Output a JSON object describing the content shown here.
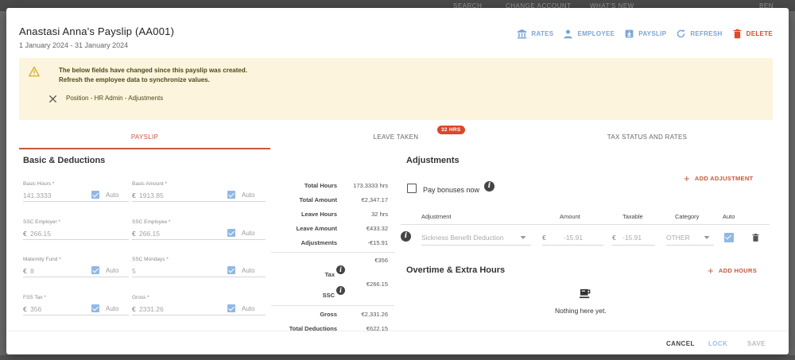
{
  "background": {
    "topbar_texts": [
      "SEARCH",
      "CHANGE ACCOUNT",
      "WHAT'S NEW",
      "BEN"
    ]
  },
  "header": {
    "title": "Anastasi Anna's Payslip (AA001)",
    "period": "1 January 2024 - 31 January 2024"
  },
  "toolbar": {
    "rates": "RATES",
    "employee": "EMPLOYEE",
    "payslip": "PAYSLIP",
    "refresh": "REFRESH",
    "delete": "DELETE",
    "accent": "#7aa6d9",
    "danger": "#e1492b"
  },
  "alert": {
    "line1": "The below fields have changed since this payslip was created.",
    "line2": "Refresh the employee data to synchronize values.",
    "change": "Position - HR Admin - Adjustments"
  },
  "tabs": {
    "payslip": "PAYSLIP",
    "leave": "LEAVE TAKEN",
    "leave_badge": "32 HRS",
    "tax": "TAX STATUS AND RATES"
  },
  "basic": {
    "title": "Basic & Deductions",
    "auto_label": "Auto",
    "currency": "€",
    "fields": {
      "basic_hours": {
        "label": "Basic Hours *",
        "value": "141.3333"
      },
      "basic_amount": {
        "label": "Basic Amount *",
        "value": "1913.85"
      },
      "ssc_employer": {
        "label": "SSC Employer *",
        "value": "266.15"
      },
      "ssc_employee": {
        "label": "SSC Employee *",
        "value": "266.15"
      },
      "maternity_fund": {
        "label": "Maternity Fund *",
        "value": "8"
      },
      "ssc_mondays": {
        "label": "SSC Mondays *",
        "value": "5"
      },
      "fss_tax": {
        "label": "FSS Tax *",
        "value": "356"
      },
      "gross": {
        "label": "Gross *",
        "value": "2331.26"
      }
    }
  },
  "summary": {
    "total_hours_label": "Total Hours",
    "total_hours": "173.3333 hrs",
    "total_amount_label": "Total Amount",
    "total_amount": "€2,347.17",
    "leave_hours_label": "Leave Hours",
    "leave_hours": "32 hrs",
    "leave_amount_label": "Leave Amount",
    "leave_amount": "€433.32",
    "adjustments_label": "Adjustments",
    "adjustments": "-€15.91",
    "tax_label": "Tax",
    "tax": "€356",
    "ssc_label": "SSC",
    "ssc": "€266.15",
    "gross_label": "Gross",
    "gross": "€2,331.26",
    "total_deductions_label": "Total Deductions",
    "total_deductions": "€622.15"
  },
  "adjustments": {
    "title": "Adjustments",
    "add_label": "ADD ADJUSTMENT",
    "pay_bonuses_label": "Pay bonuses now",
    "columns": {
      "adjustment": "Adjustment",
      "amount": "Amount",
      "taxable": "Taxable",
      "category": "Category",
      "auto": "Auto"
    },
    "row": {
      "name": "Sickness Benefit Deduction",
      "currency": "€",
      "amount": "-15.91",
      "taxable": "-15.91",
      "category": "OTHER"
    }
  },
  "overtime": {
    "title": "Overtime & Extra Hours",
    "add_label": "ADD HOURS",
    "empty": "Nothing here yet."
  },
  "footer": {
    "cancel": "CANCEL",
    "lock": "LOCK",
    "save": "SAVE"
  }
}
